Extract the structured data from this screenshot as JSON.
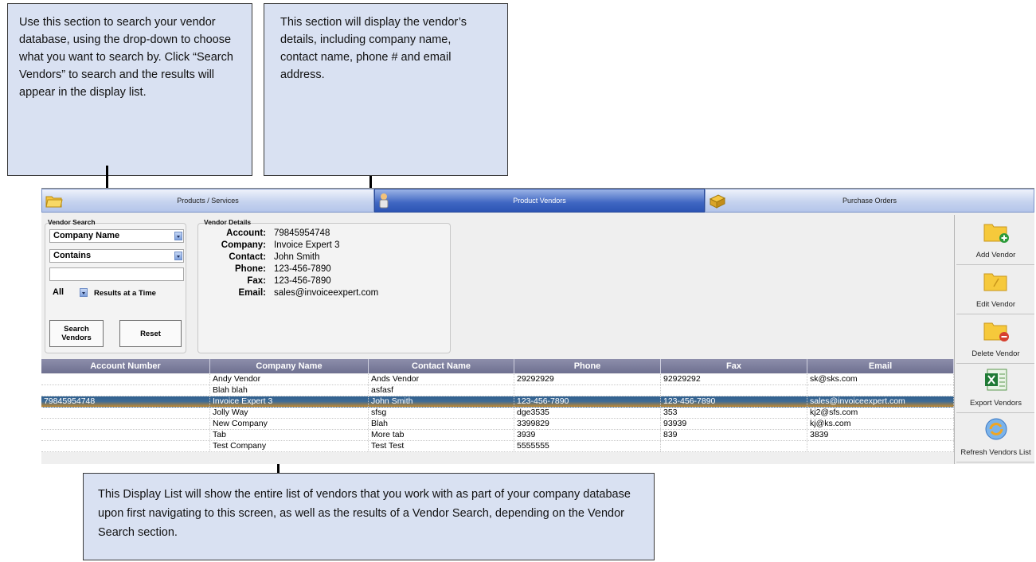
{
  "callouts": {
    "search_help": "Use this section to search your vendor database, using the drop-down to choose what you want to search by. Click “Search Vendors” to search and the results will appear in the display list.",
    "details_help": "This section will display the vendor’s details, including company name, contact name, phone # and email address.",
    "list_help": "This Display List will show the entire list of vendors that you work with as part of your company database upon first navigating to this screen, as well as the results of a Vendor Search, depending on the Vendor Search section."
  },
  "tabs": [
    {
      "label": "Products / Services",
      "icon": "folder-icon"
    },
    {
      "label": "Product Vendors",
      "icon": "vendor-person-icon"
    },
    {
      "label": "Purchase Orders",
      "icon": "orders-icon"
    }
  ],
  "search": {
    "title": "Vendor Search",
    "field_select": "Company Name",
    "match_select": "Contains",
    "query_value": "",
    "results_select": "All",
    "results_label": "Results at a Time",
    "search_button": "Search Vendors",
    "reset_button": "Reset"
  },
  "details": {
    "title": "Vendor Details",
    "rows": [
      {
        "label": "Account:",
        "value": "79845954748"
      },
      {
        "label": "Company:",
        "value": "Invoice Expert 3"
      },
      {
        "label": "Contact:",
        "value": "John Smith"
      },
      {
        "label": "Phone:",
        "value": "123-456-7890"
      },
      {
        "label": "Fax:",
        "value": "123-456-7890"
      },
      {
        "label": "Email:",
        "value": "sales@invoiceexpert.com"
      }
    ]
  },
  "grid": {
    "columns": [
      "Account Number",
      "Company Name",
      "Contact Name",
      "Phone",
      "Fax",
      "Email"
    ],
    "rows": [
      [
        "",
        "Andy Vendor",
        "Ands Vendor",
        "29292929",
        "92929292",
        "sk@sks.com"
      ],
      [
        "",
        "Blah blah",
        "asfasf",
        "",
        "",
        ""
      ],
      [
        "79845954748",
        "Invoice Expert 3",
        "John Smith",
        "123-456-7890",
        "123-456-7890",
        "sales@invoiceexpert.com"
      ],
      [
        "",
        "Jolly Way",
        "sfsg",
        "dge3535",
        "353",
        "kj2@sfs.com"
      ],
      [
        "",
        "New Company",
        "Blah",
        "3399829",
        "93939",
        "kj@ks.com"
      ],
      [
        "",
        "Tab",
        "More tab",
        "3939",
        "839",
        "3839"
      ],
      [
        "",
        "Test Company",
        "Test Test",
        "5555555",
        "",
        ""
      ]
    ],
    "selected_row": 2
  },
  "sidebar": [
    {
      "label": "Add Vendor",
      "icon": "add-folder-icon"
    },
    {
      "label": "Edit Vendor",
      "icon": "edit-folder-icon"
    },
    {
      "label": "Delete Vendor",
      "icon": "delete-folder-icon"
    },
    {
      "label": "Export Vendors",
      "icon": "excel-export-icon"
    },
    {
      "label": "Refresh Vendors List",
      "icon": "refresh-icon"
    }
  ],
  "colors": {
    "callout_bg": "#d9e1f2",
    "grid_header": "#7a7c9a",
    "selected_row": "#406c95",
    "active_tab": "#3f66c2"
  }
}
